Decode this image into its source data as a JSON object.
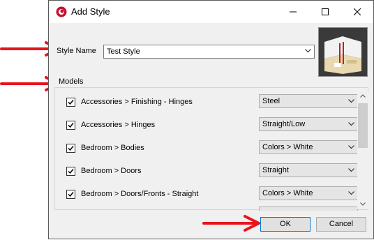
{
  "window": {
    "title": "Add Style"
  },
  "style_name": {
    "label": "Style Name",
    "value": "Test Style"
  },
  "models": {
    "label": "Models",
    "rows": [
      {
        "name": "Accessories > Finishing - Hinges",
        "checked": true,
        "option": "Steel"
      },
      {
        "name": "Accessories > Hinges",
        "checked": true,
        "option": "Straight/Low"
      },
      {
        "name": "Bedroom > Bodies",
        "checked": true,
        "option": "Colors > White"
      },
      {
        "name": "Bedroom > Doors",
        "checked": true,
        "option": "Straight"
      },
      {
        "name": "Bedroom > Doors/Fronts - Straight",
        "checked": true,
        "option": "Colors > White"
      }
    ]
  },
  "buttons": {
    "ok": "OK",
    "cancel": "Cancel"
  },
  "colors": {
    "annotation_arrow": "#e8141c",
    "app_icon": "#c8102e"
  },
  "icons": [
    "app-logo-icon",
    "minimize-icon",
    "maximize-icon",
    "close-icon",
    "chevron-down-icon",
    "checkmark-icon",
    "scroll-up-icon",
    "scroll-down-icon"
  ]
}
